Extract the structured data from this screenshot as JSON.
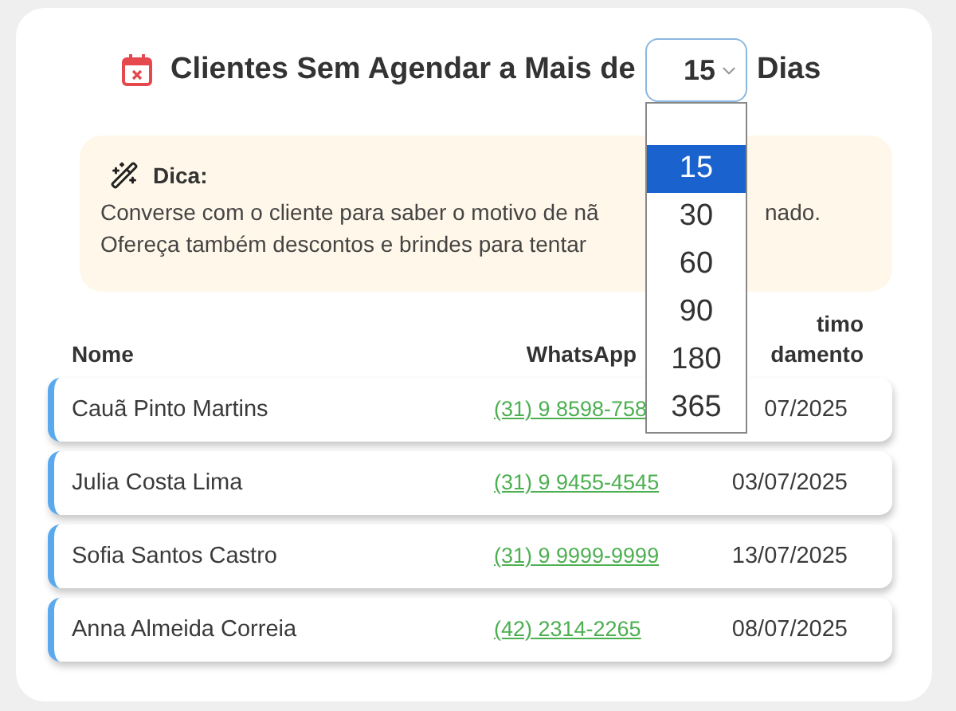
{
  "title": {
    "text": "Clientes Sem Agendar a Mais de",
    "suffix": "Dias"
  },
  "select": {
    "value": "15",
    "options": [
      {
        "label": "15",
        "selected": true
      },
      {
        "label": "30",
        "selected": false
      },
      {
        "label": "60",
        "selected": false
      },
      {
        "label": "90",
        "selected": false
      },
      {
        "label": "180",
        "selected": false
      },
      {
        "label": "365",
        "selected": false
      }
    ]
  },
  "tip": {
    "heading": "Dica:",
    "lines": [
      [
        "Converse com o cliente para saber o motivo de nã",
        "nado."
      ],
      [
        "Ofereça também descontos e brindes para tentar"
      ]
    ]
  },
  "table": {
    "columns": [
      {
        "lines": [
          "Nome"
        ]
      },
      {
        "lines": [
          "WhatsApp"
        ]
      },
      {
        "lines": [
          "timo",
          "damento"
        ]
      }
    ],
    "rows": [
      {
        "name": "Cauã Pinto Martins",
        "phone": "(31) 9 8598-758",
        "date": "07/2025"
      },
      {
        "name": "Julia Costa Lima",
        "phone": "(31) 9 9455-4545",
        "date": "03/07/2025"
      },
      {
        "name": "Sofia Santos Castro",
        "phone": "(31) 9 9999-9999",
        "date": "13/07/2025"
      },
      {
        "name": "Anna Almeida Correia",
        "phone": "(42) 2314-2265",
        "date": "08/07/2025"
      }
    ]
  }
}
